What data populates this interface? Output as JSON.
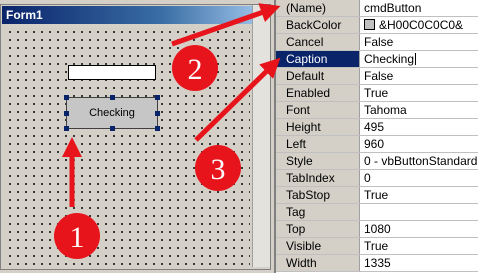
{
  "form": {
    "title": "Form1",
    "button_caption": "Checking"
  },
  "properties": [
    {
      "name": "(Name)",
      "value": "cmdButton"
    },
    {
      "name": "BackColor",
      "value": "&H00C0C0C0&",
      "swatch": "#c0c0c0"
    },
    {
      "name": "Cancel",
      "value": "False"
    },
    {
      "name": "Caption",
      "value": "Checking",
      "selected": true
    },
    {
      "name": "Default",
      "value": "False"
    },
    {
      "name": "Enabled",
      "value": "True"
    },
    {
      "name": "Font",
      "value": "Tahoma"
    },
    {
      "name": "Height",
      "value": "495"
    },
    {
      "name": "Left",
      "value": "960"
    },
    {
      "name": "Style",
      "value": "0 - vbButtonStandard"
    },
    {
      "name": "TabIndex",
      "value": "0"
    },
    {
      "name": "TabStop",
      "value": "True"
    },
    {
      "name": "Tag",
      "value": ""
    },
    {
      "name": "Top",
      "value": "1080"
    },
    {
      "name": "Visible",
      "value": "True"
    },
    {
      "name": "Width",
      "value": "1335"
    }
  ],
  "annotations": {
    "badge1": "1",
    "badge2": "2",
    "badge3": "3",
    "color": "#e8141b"
  }
}
